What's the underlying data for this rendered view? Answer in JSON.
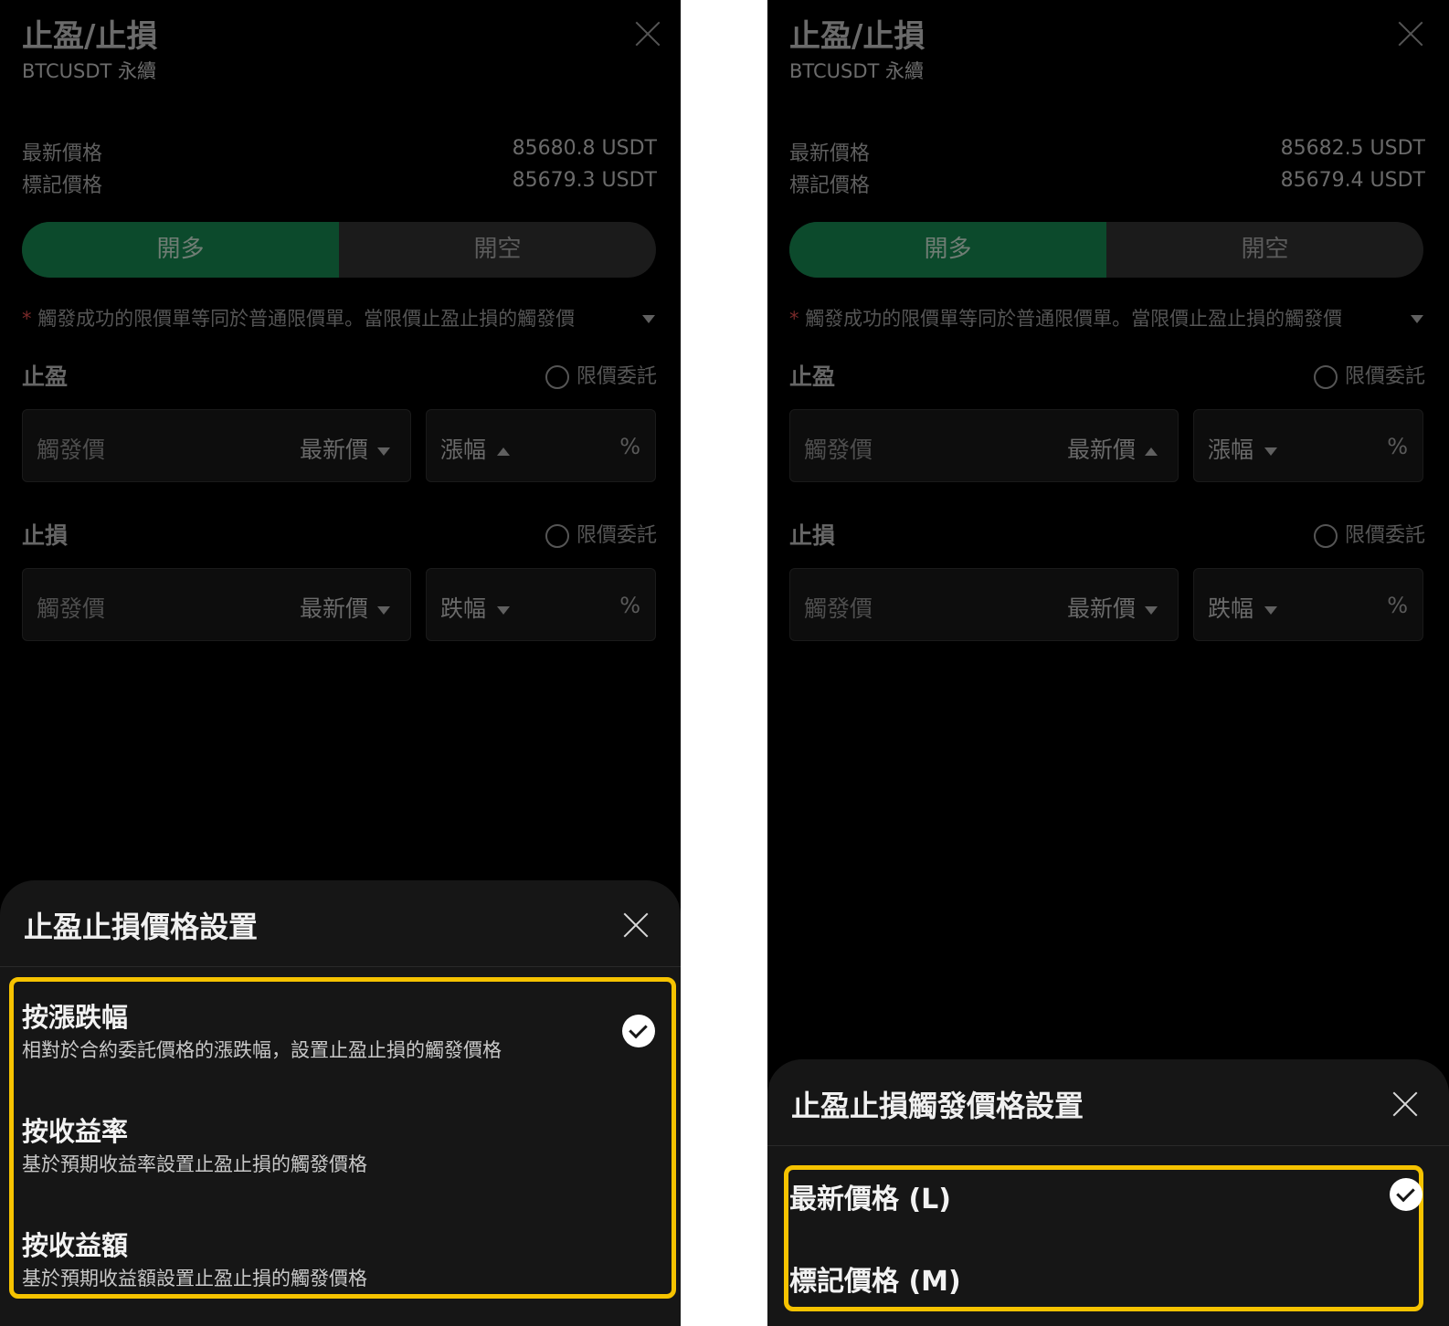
{
  "left": {
    "title": "止盈/止損",
    "subtitle": "BTCUSDT 永續",
    "latest_price_label": "最新價格",
    "latest_price_value": "85680.8 USDT",
    "mark_price_label": "標記價格",
    "mark_price_value": "85679.3 USDT",
    "long_label": "開多",
    "short_label": "開空",
    "notice_star": "*",
    "notice_text": "觸發成功的限價單等同於普通限價單。當限價止盈止損的觸發價",
    "tp_label": "止盈",
    "tp_limit_label": "限價委託",
    "tp_trigger_placeholder": "觸發價",
    "tp_price_type": "最新價",
    "tp_change_label": "漲幅",
    "tp_unit": "%",
    "sl_label": "止損",
    "sl_limit_label": "限價委託",
    "sl_trigger_placeholder": "觸發價",
    "sl_price_type": "最新價",
    "sl_change_label": "跌幅",
    "sl_unit": "%",
    "sheet": {
      "title": "止盈止損價格設置",
      "options": [
        {
          "title": "按漲跌幅",
          "desc": "相對於合約委託價格的漲跌幅，設置止盈止損的觸發價格",
          "selected": true
        },
        {
          "title": "按收益率",
          "desc": "基於預期收益率設置止盈止損的觸發價格",
          "selected": false
        },
        {
          "title": "按收益額",
          "desc": "基於預期收益額設置止盈止損的觸發價格",
          "selected": false
        }
      ]
    }
  },
  "right": {
    "title": "止盈/止損",
    "subtitle": "BTCUSDT 永續",
    "latest_price_label": "最新價格",
    "latest_price_value": "85682.5 USDT",
    "mark_price_label": "標記價格",
    "mark_price_value": "85679.4 USDT",
    "long_label": "開多",
    "short_label": "開空",
    "notice_star": "*",
    "notice_text": "觸發成功的限價單等同於普通限價單。當限價止盈止損的觸發價",
    "tp_label": "止盈",
    "tp_limit_label": "限價委託",
    "tp_trigger_placeholder": "觸發價",
    "tp_price_type": "最新價",
    "tp_change_label": "漲幅",
    "tp_unit": "%",
    "sl_label": "止損",
    "sl_limit_label": "限價委託",
    "sl_trigger_placeholder": "觸發價",
    "sl_price_type": "最新價",
    "sl_change_label": "跌幅",
    "sl_unit": "%",
    "sheet": {
      "title": "止盈止損觸發價格設置",
      "options": [
        {
          "title": "最新價格 (L)",
          "selected": true
        },
        {
          "title": "標記價格 (M)",
          "selected": false
        }
      ]
    }
  },
  "colors": {
    "highlight": "#f6c300",
    "long_green": "#0c4a2c",
    "sheet_bg": "#161616"
  }
}
